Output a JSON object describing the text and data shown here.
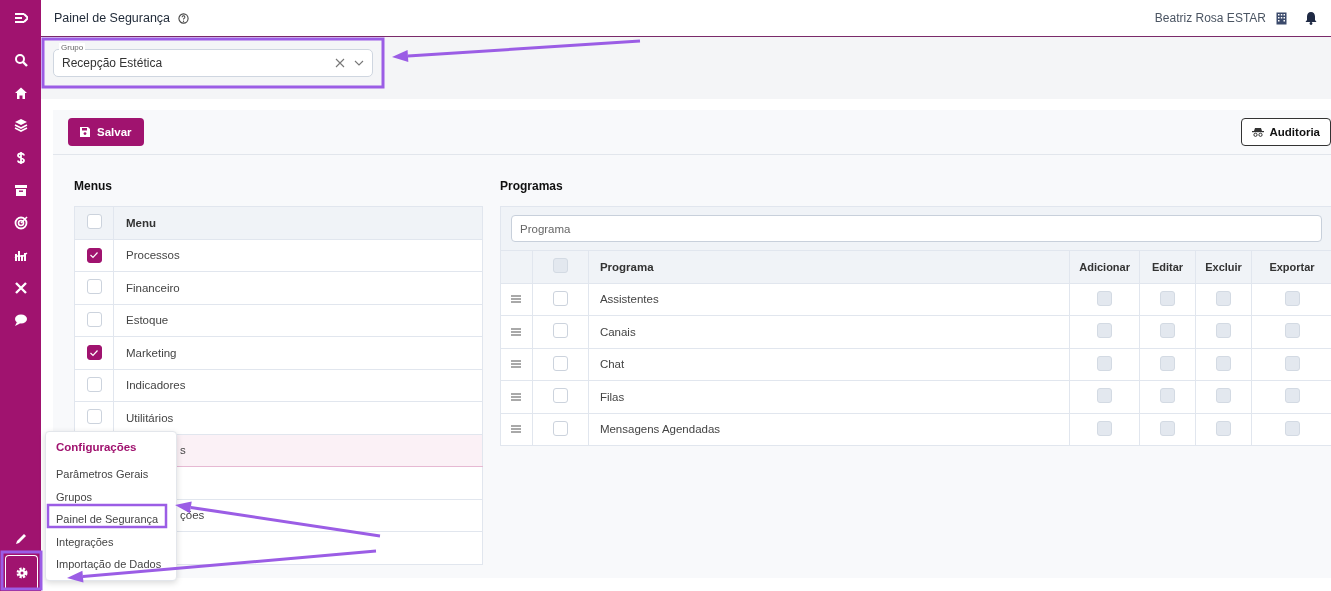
{
  "sidebar": {
    "items": [
      {
        "selected": false
      },
      {
        "selected": false
      },
      {
        "selected": false
      },
      {
        "selected": false
      },
      {
        "selected": false
      },
      {
        "selected": false
      },
      {
        "selected": false
      },
      {
        "selected": false
      },
      {
        "selected": false
      },
      {
        "selected": false
      },
      {
        "selected": false
      },
      {
        "selected": true
      }
    ]
  },
  "header": {
    "title": "Painel de Segurança",
    "user": "Beatriz Rosa ESTAR"
  },
  "group_field": {
    "label": "Grupo",
    "value": "Recepção Estética"
  },
  "toolbar": {
    "save_button": "Salvar",
    "audit_button": "Auditoria"
  },
  "menus": {
    "title": "Menus",
    "column": "Menu",
    "header_checked": false,
    "rows": [
      {
        "label": "Processos",
        "checked": true,
        "highlighted": false
      },
      {
        "label": "Financeiro",
        "checked": false,
        "highlighted": false
      },
      {
        "label": "Estoque",
        "checked": false,
        "highlighted": false
      },
      {
        "label": "Marketing",
        "checked": true,
        "highlighted": false
      },
      {
        "label": "Indicadores",
        "checked": false,
        "highlighted": false
      },
      {
        "label": "Utilitários",
        "checked": false,
        "highlighted": false
      },
      {
        "label": "s",
        "highlighted": true
      },
      {
        "highlighted": false
      },
      {
        "label": "ções",
        "highlighted": false
      },
      {
        "highlighted": false
      }
    ]
  },
  "programs": {
    "title": "Programas",
    "search_placeholder": "Programa",
    "header_checkbox": {
      "checked": false,
      "disabled": true
    },
    "columns": [
      "Programa",
      "Adicionar",
      "Editar",
      "Excluir",
      "Exportar"
    ],
    "rows": [
      {
        "name": "Assistentes",
        "checked": false,
        "permissions": [
          {
            "checked": false,
            "disabled": true
          },
          {
            "checked": false,
            "disabled": true
          },
          {
            "checked": false,
            "disabled": true
          },
          {
            "checked": false,
            "disabled": true
          }
        ]
      },
      {
        "name": "Canais",
        "checked": false,
        "permissions": [
          {
            "checked": false,
            "disabled": true
          },
          {
            "checked": false,
            "disabled": true
          },
          {
            "checked": false,
            "disabled": true
          },
          {
            "checked": false,
            "disabled": true
          }
        ]
      },
      {
        "name": "Chat",
        "checked": false,
        "permissions": [
          {
            "checked": false,
            "disabled": true
          },
          {
            "checked": false,
            "disabled": true
          },
          {
            "checked": false,
            "disabled": true
          },
          {
            "checked": false,
            "disabled": true
          }
        ]
      },
      {
        "name": "Filas",
        "checked": false,
        "permissions": [
          {
            "checked": false,
            "disabled": true
          },
          {
            "checked": false,
            "disabled": true
          },
          {
            "checked": false,
            "disabled": true
          },
          {
            "checked": false,
            "disabled": true
          }
        ]
      },
      {
        "name": "Mensagens Agendadas",
        "checked": false,
        "permissions": [
          {
            "checked": false,
            "disabled": true
          },
          {
            "checked": false,
            "disabled": true
          },
          {
            "checked": false,
            "disabled": true
          },
          {
            "checked": false,
            "disabled": true
          }
        ]
      }
    ]
  },
  "settings_menu": {
    "title": "Configurações",
    "items": [
      {
        "label": "Parâmetros Gerais"
      },
      {
        "label": "Grupos"
      },
      {
        "label": "Painel de Segurança"
      },
      {
        "label": "Integrações"
      },
      {
        "label": "Importação de Dados"
      }
    ]
  }
}
